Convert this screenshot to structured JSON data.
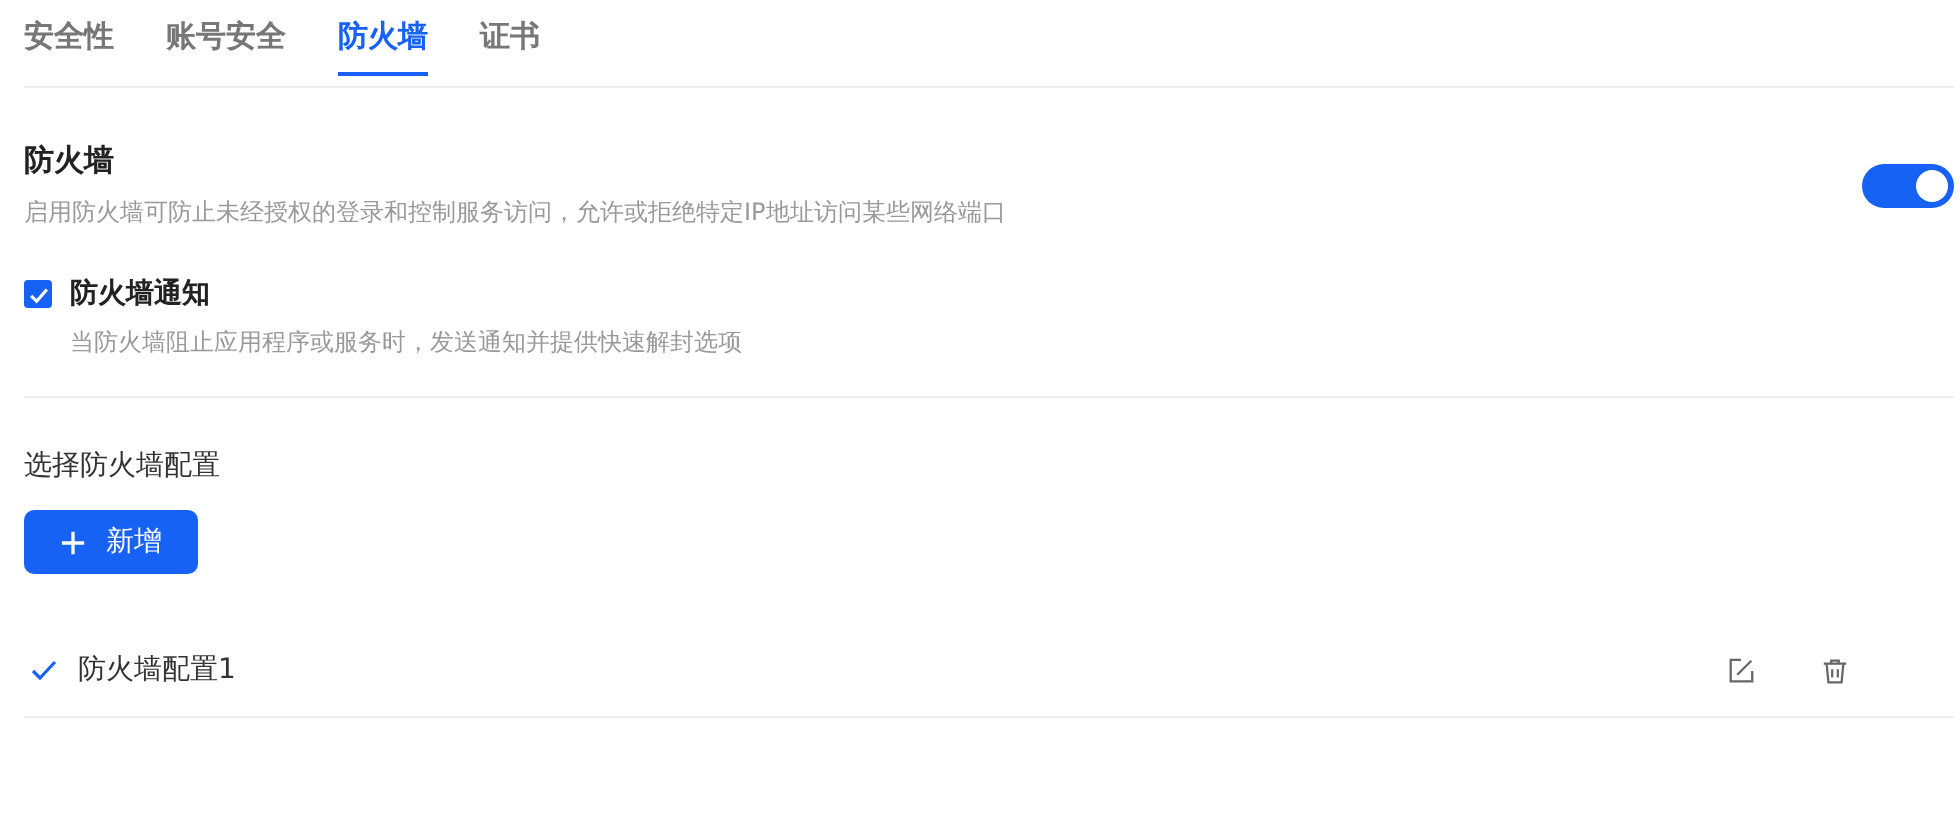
{
  "tabs": [
    {
      "label": "安全性",
      "selected": false
    },
    {
      "label": "账号安全",
      "selected": false
    },
    {
      "label": "防火墙",
      "selected": true
    },
    {
      "label": "证书",
      "selected": false
    }
  ],
  "firewall": {
    "title": "防火墙",
    "description": "启用防火墙可防止未经授权的登录和控制服务访问，允许或拒绝特定IP地址访问某些网络端口",
    "on": true
  },
  "notification": {
    "label": "防火墙通知",
    "description": "当防火墙阻止应用程序或服务时，发送通知并提供快速解封选项",
    "checked": true
  },
  "config": {
    "heading": "选择防火墙配置",
    "add_button": "新增",
    "items": [
      {
        "name": "防火墙配置1",
        "selected": true
      }
    ]
  }
}
